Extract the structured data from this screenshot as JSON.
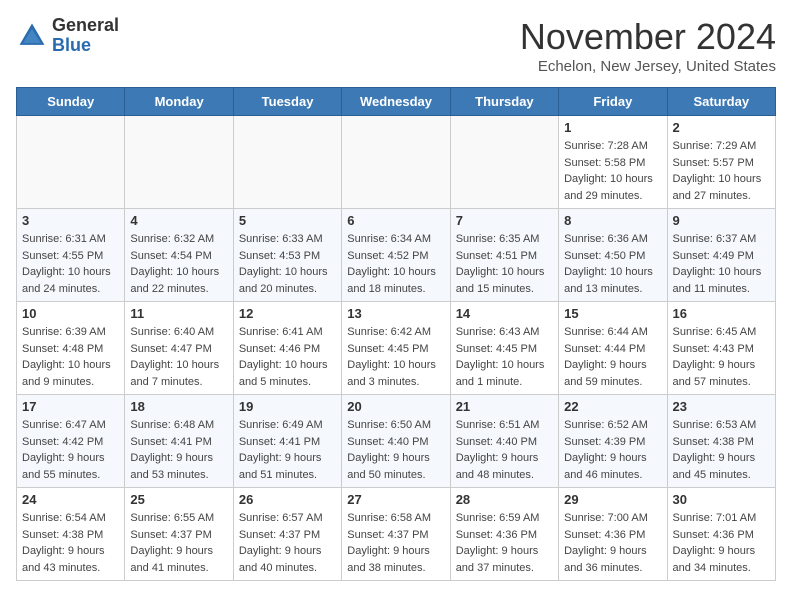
{
  "header": {
    "logo_line1": "General",
    "logo_line2": "Blue",
    "month": "November 2024",
    "location": "Echelon, New Jersey, United States"
  },
  "weekdays": [
    "Sunday",
    "Monday",
    "Tuesday",
    "Wednesday",
    "Thursday",
    "Friday",
    "Saturday"
  ],
  "weeks": [
    [
      {
        "day": "",
        "info": ""
      },
      {
        "day": "",
        "info": ""
      },
      {
        "day": "",
        "info": ""
      },
      {
        "day": "",
        "info": ""
      },
      {
        "day": "",
        "info": ""
      },
      {
        "day": "1",
        "info": "Sunrise: 7:28 AM\nSunset: 5:58 PM\nDaylight: 10 hours and 29 minutes."
      },
      {
        "day": "2",
        "info": "Sunrise: 7:29 AM\nSunset: 5:57 PM\nDaylight: 10 hours and 27 minutes."
      }
    ],
    [
      {
        "day": "3",
        "info": "Sunrise: 6:31 AM\nSunset: 4:55 PM\nDaylight: 10 hours and 24 minutes."
      },
      {
        "day": "4",
        "info": "Sunrise: 6:32 AM\nSunset: 4:54 PM\nDaylight: 10 hours and 22 minutes."
      },
      {
        "day": "5",
        "info": "Sunrise: 6:33 AM\nSunset: 4:53 PM\nDaylight: 10 hours and 20 minutes."
      },
      {
        "day": "6",
        "info": "Sunrise: 6:34 AM\nSunset: 4:52 PM\nDaylight: 10 hours and 18 minutes."
      },
      {
        "day": "7",
        "info": "Sunrise: 6:35 AM\nSunset: 4:51 PM\nDaylight: 10 hours and 15 minutes."
      },
      {
        "day": "8",
        "info": "Sunrise: 6:36 AM\nSunset: 4:50 PM\nDaylight: 10 hours and 13 minutes."
      },
      {
        "day": "9",
        "info": "Sunrise: 6:37 AM\nSunset: 4:49 PM\nDaylight: 10 hours and 11 minutes."
      }
    ],
    [
      {
        "day": "10",
        "info": "Sunrise: 6:39 AM\nSunset: 4:48 PM\nDaylight: 10 hours and 9 minutes."
      },
      {
        "day": "11",
        "info": "Sunrise: 6:40 AM\nSunset: 4:47 PM\nDaylight: 10 hours and 7 minutes."
      },
      {
        "day": "12",
        "info": "Sunrise: 6:41 AM\nSunset: 4:46 PM\nDaylight: 10 hours and 5 minutes."
      },
      {
        "day": "13",
        "info": "Sunrise: 6:42 AM\nSunset: 4:45 PM\nDaylight: 10 hours and 3 minutes."
      },
      {
        "day": "14",
        "info": "Sunrise: 6:43 AM\nSunset: 4:45 PM\nDaylight: 10 hours and 1 minute."
      },
      {
        "day": "15",
        "info": "Sunrise: 6:44 AM\nSunset: 4:44 PM\nDaylight: 9 hours and 59 minutes."
      },
      {
        "day": "16",
        "info": "Sunrise: 6:45 AM\nSunset: 4:43 PM\nDaylight: 9 hours and 57 minutes."
      }
    ],
    [
      {
        "day": "17",
        "info": "Sunrise: 6:47 AM\nSunset: 4:42 PM\nDaylight: 9 hours and 55 minutes."
      },
      {
        "day": "18",
        "info": "Sunrise: 6:48 AM\nSunset: 4:41 PM\nDaylight: 9 hours and 53 minutes."
      },
      {
        "day": "19",
        "info": "Sunrise: 6:49 AM\nSunset: 4:41 PM\nDaylight: 9 hours and 51 minutes."
      },
      {
        "day": "20",
        "info": "Sunrise: 6:50 AM\nSunset: 4:40 PM\nDaylight: 9 hours and 50 minutes."
      },
      {
        "day": "21",
        "info": "Sunrise: 6:51 AM\nSunset: 4:40 PM\nDaylight: 9 hours and 48 minutes."
      },
      {
        "day": "22",
        "info": "Sunrise: 6:52 AM\nSunset: 4:39 PM\nDaylight: 9 hours and 46 minutes."
      },
      {
        "day": "23",
        "info": "Sunrise: 6:53 AM\nSunset: 4:38 PM\nDaylight: 9 hours and 45 minutes."
      }
    ],
    [
      {
        "day": "24",
        "info": "Sunrise: 6:54 AM\nSunset: 4:38 PM\nDaylight: 9 hours and 43 minutes."
      },
      {
        "day": "25",
        "info": "Sunrise: 6:55 AM\nSunset: 4:37 PM\nDaylight: 9 hours and 41 minutes."
      },
      {
        "day": "26",
        "info": "Sunrise: 6:57 AM\nSunset: 4:37 PM\nDaylight: 9 hours and 40 minutes."
      },
      {
        "day": "27",
        "info": "Sunrise: 6:58 AM\nSunset: 4:37 PM\nDaylight: 9 hours and 38 minutes."
      },
      {
        "day": "28",
        "info": "Sunrise: 6:59 AM\nSunset: 4:36 PM\nDaylight: 9 hours and 37 minutes."
      },
      {
        "day": "29",
        "info": "Sunrise: 7:00 AM\nSunset: 4:36 PM\nDaylight: 9 hours and 36 minutes."
      },
      {
        "day": "30",
        "info": "Sunrise: 7:01 AM\nSunset: 4:36 PM\nDaylight: 9 hours and 34 minutes."
      }
    ]
  ]
}
